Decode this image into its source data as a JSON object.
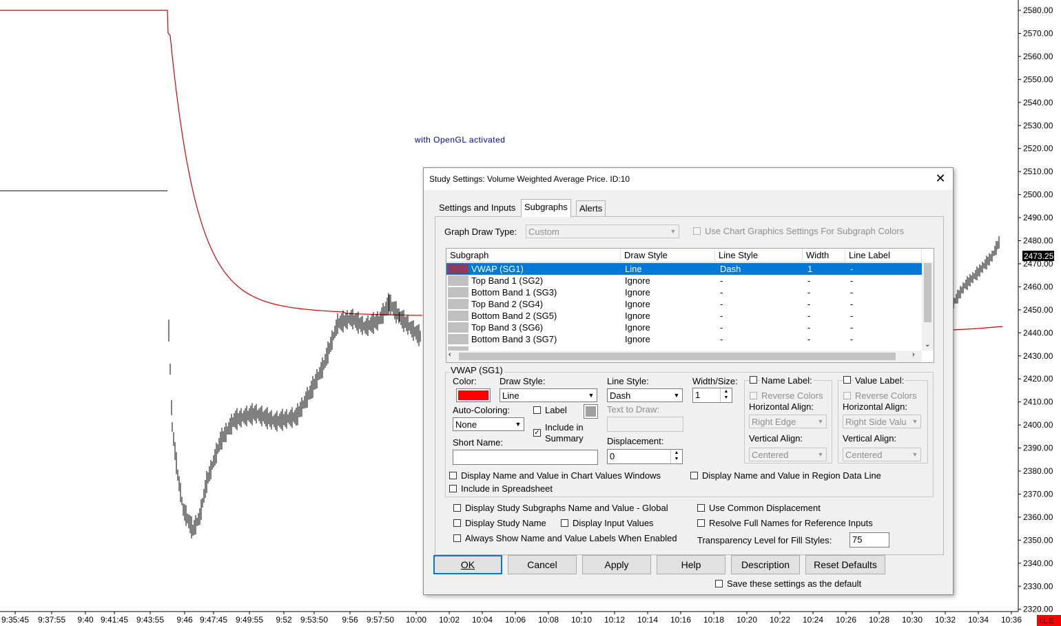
{
  "chart": {
    "overlay_text": "with OpenGL activated",
    "price_labels": [
      "2580.00",
      "2570.00",
      "2560.00",
      "2550.00",
      "2540.00",
      "2530.00",
      "2520.00",
      "2510.00",
      "2500.00",
      "2490.00",
      "2480.00",
      "2470.00",
      "2460.00",
      "2450.00",
      "2440.00",
      "2430.00",
      "2420.00",
      "2410.00",
      "2400.00",
      "2390.00",
      "2380.00",
      "2370.00",
      "2360.00",
      "2350.00",
      "2340.00",
      "2330.00",
      "2320.00"
    ],
    "current_price": "2473.25",
    "time_labels": [
      "9:35:45",
      "9:37:55",
      "9:40",
      "9:41:45",
      "9:43:55",
      "9:46",
      "9:47:45",
      "9:49:55",
      "9:52",
      "9:53:50",
      "9:56",
      "9:57:50",
      "10:00",
      "10:02",
      "10:04",
      "10:06",
      "10:08",
      "10:10",
      "10:12",
      "10:14",
      "10:16",
      "10:18",
      "10:20",
      "10:22",
      "10:24",
      "10:26",
      "10:28",
      "10:30",
      "10:32",
      "10:34",
      "10:36"
    ],
    "corner_badge": "I.L.E",
    "colors": {
      "vwap": "#d40000",
      "price": "#000000",
      "current_price_bg": "#000000",
      "badge_bg": "#ff0000"
    }
  },
  "dialog": {
    "title": "Study Settings: Volume Weighted Average Price. ID:10",
    "tabs": [
      "Settings and Inputs",
      "Subgraphs",
      "Alerts"
    ],
    "active_tab": "Subgraphs",
    "graph_draw_type_label": "Graph Draw Type:",
    "graph_draw_type_value": "Custom",
    "use_chart_graphics_label": "Use Chart Graphics Settings For Subgraph Colors",
    "table": {
      "headers": [
        "Subgraph",
        "Draw Style",
        "Line Style",
        "Width",
        "Line Label"
      ],
      "rows": [
        {
          "subgraph": "VWAP (SG1)",
          "draw_style": "Line",
          "line_style": "Dash",
          "width": "1",
          "line_label": "-"
        },
        {
          "subgraph": "Top Band 1 (SG2)",
          "draw_style": "Ignore",
          "line_style": "-",
          "width": "-",
          "line_label": "-"
        },
        {
          "subgraph": "Bottom Band 1 (SG3)",
          "draw_style": "Ignore",
          "line_style": "-",
          "width": "-",
          "line_label": "-"
        },
        {
          "subgraph": "Top Band 2 (SG4)",
          "draw_style": "Ignore",
          "line_style": "-",
          "width": "-",
          "line_label": "-"
        },
        {
          "subgraph": "Bottom Band 2 (SG5)",
          "draw_style": "Ignore",
          "line_style": "-",
          "width": "-",
          "line_label": "-"
        },
        {
          "subgraph": "Top Band 3 (SG6)",
          "draw_style": "Ignore",
          "line_style": "-",
          "width": "-",
          "line_label": "-"
        },
        {
          "subgraph": "Bottom Band 3 (SG7)",
          "draw_style": "Ignore",
          "line_style": "-",
          "width": "-",
          "line_label": "-"
        }
      ]
    },
    "group_title": "VWAP (SG1)",
    "color_label": "Color:",
    "color_value": "#ff0000",
    "draw_style_label": "Draw Style:",
    "draw_style_value": "Line",
    "line_style_label": "Line Style:",
    "line_style_value": "Dash",
    "width_label": "Width/Size:",
    "width_value": "1",
    "auto_coloring_label": "Auto-Coloring:",
    "auto_coloring_value": "None",
    "label_checkbox": "Label",
    "include_summary_line1": "Include in",
    "include_summary_line2": "Summary",
    "text_to_draw_label": "Text to Draw:",
    "short_name_label": "Short Name:",
    "displacement_label": "Displacement:",
    "displacement_value": "0",
    "name_label": {
      "title": "Name Label:",
      "reverse_colors": "Reverse Colors",
      "h_align_label": "Horizontal Align:",
      "h_align_value": "Right Edge",
      "v_align_label": "Vertical Align:",
      "v_align_value": "Centered"
    },
    "value_label": {
      "title": "Value Label:",
      "reverse_colors": "Reverse Colors",
      "h_align_label": "Horizontal Align:",
      "h_align_value": "Right Side Valu",
      "v_align_label": "Vertical Align:",
      "v_align_value": "Centered"
    },
    "display_chart_values": "Display Name and Value in Chart Values Windows",
    "display_region_data": "Display Name and Value in Region Data Line",
    "include_spreadsheet": "Include in Spreadsheet",
    "display_global": "Display Study Subgraphs Name and Value - Global",
    "use_common_displacement": "Use Common Displacement",
    "display_study_name": "Display Study Name",
    "display_input_values": "Display Input Values",
    "resolve_full_names": "Resolve Full Names for Reference Inputs",
    "always_show": "Always Show Name and Value Labels When Enabled",
    "transparency_label": "Transparency Level for Fill Styles:",
    "transparency_value": "75",
    "buttons": {
      "ok": "OK",
      "cancel": "Cancel",
      "apply": "Apply",
      "help": "Help",
      "description": "Description",
      "reset": "Reset Defaults"
    },
    "save_default": "Save these settings as the default",
    "close_glyph": "✕"
  }
}
